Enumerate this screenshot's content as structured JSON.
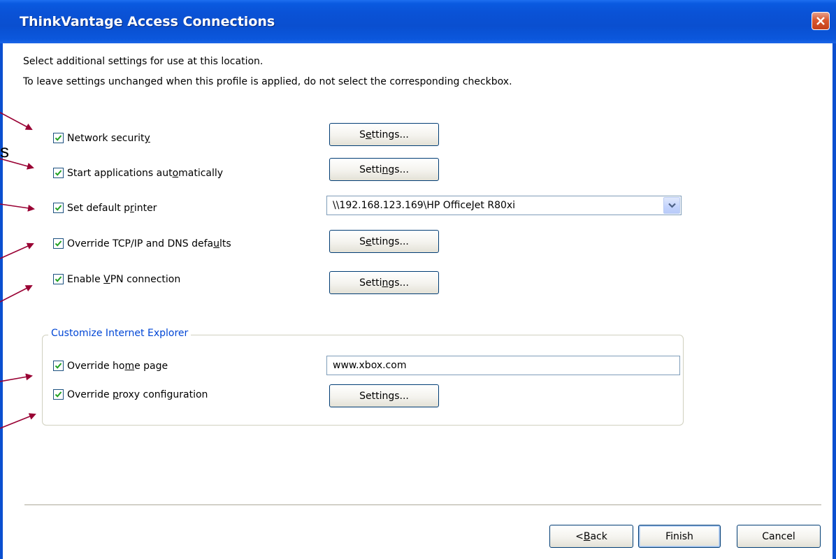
{
  "window": {
    "title": "ThinkVantage Access Connections"
  },
  "instructions": {
    "line1": "Select additional settings for use at this location.",
    "line2": "To leave settings unchanged when this profile is applied, do not select the corresponding checkbox."
  },
  "options": {
    "network_security": {
      "label_pre": "Network securit",
      "label_mnemonic": "y",
      "label_post": "",
      "checked": true,
      "button": {
        "pre": "S",
        "mnemonic": "e",
        "post": "ttings..."
      }
    },
    "start_apps": {
      "label_pre": "Start applications aut",
      "label_mnemonic": "o",
      "label_post": "matically",
      "checked": true,
      "button": {
        "pre": "Setti",
        "mnemonic": "n",
        "post": "gs..."
      }
    },
    "default_printer": {
      "label_pre": "Set default p",
      "label_mnemonic": "r",
      "label_post": "inter",
      "checked": true,
      "selected_value": "\\\\192.168.123.169\\HP OfficeJet R80xi"
    },
    "tcpip": {
      "label_pre": "Override TCP/IP and DNS defa",
      "label_mnemonic": "u",
      "label_post": "lts",
      "checked": true,
      "button": {
        "pre": "S",
        "mnemonic": "e",
        "post": "ttings..."
      }
    },
    "vpn": {
      "label_pre": "Enable ",
      "label_mnemonic": "V",
      "label_post": "PN connection",
      "checked": true,
      "button": {
        "pre": "Setti",
        "mnemonic": "n",
        "post": "gs..."
      }
    }
  },
  "ie_group": {
    "legend": "Customize Internet Explorer",
    "home_page": {
      "label_pre": "Override ho",
      "label_mnemonic": "m",
      "label_post": "e page",
      "checked": true,
      "value": "www.xbox.com"
    },
    "proxy": {
      "label_pre": "Override ",
      "label_mnemonic": "p",
      "label_post": "roxy configuration",
      "checked": true,
      "button": {
        "pre": "Settings...",
        "mnemonic": "",
        "post": ""
      }
    }
  },
  "footer": {
    "back": {
      "pre": "< ",
      "mnemonic": "B",
      "post": "ack"
    },
    "finish": "Finish",
    "cancel": "Cancel"
  },
  "annotation": {
    "stray_letter": "s",
    "arrow_color": "#990033"
  },
  "colors": {
    "titlebar": "#0a52d6",
    "group_legend": "#0046d5",
    "checkmark": "#21a121"
  }
}
